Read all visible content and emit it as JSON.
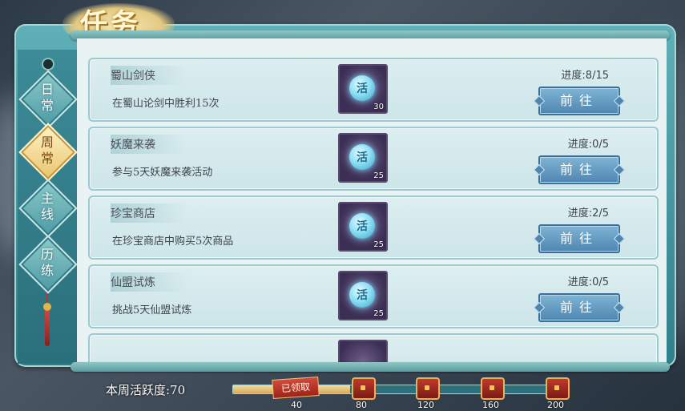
{
  "header": {
    "title": "任务"
  },
  "nav": {
    "tabs": [
      {
        "label": "日常",
        "active": false
      },
      {
        "label": "周常",
        "active": true
      },
      {
        "label": "主线",
        "active": false
      },
      {
        "label": "历练",
        "active": false
      }
    ]
  },
  "tasks": [
    {
      "name": "蜀山剑侠",
      "desc": "在蜀山论剑中胜利15次",
      "progress": "进度:8/15",
      "reward_icon": "活",
      "reward_count": "30",
      "button": "前往"
    },
    {
      "name": "妖魔来袭",
      "desc": "参与5天妖魔来袭活动",
      "progress": "进度:0/5",
      "reward_icon": "活",
      "reward_count": "25",
      "button": "前往"
    },
    {
      "name": "珍宝商店",
      "desc": "在珍宝商店中购买5次商品",
      "progress": "进度:2/5",
      "reward_icon": "活",
      "reward_count": "25",
      "button": "前往"
    },
    {
      "name": "仙盟试炼",
      "desc": "挑战5天仙盟试炼",
      "progress": "进度:0/5",
      "reward_icon": "活",
      "reward_count": "25",
      "button": "前往"
    }
  ],
  "footer": {
    "activity_label": "本周活跃度:70",
    "activity_value": 70,
    "activity_max": 200,
    "claimed_label": "已领取",
    "milestones": [
      "40",
      "80",
      "120",
      "160",
      "200"
    ]
  }
}
